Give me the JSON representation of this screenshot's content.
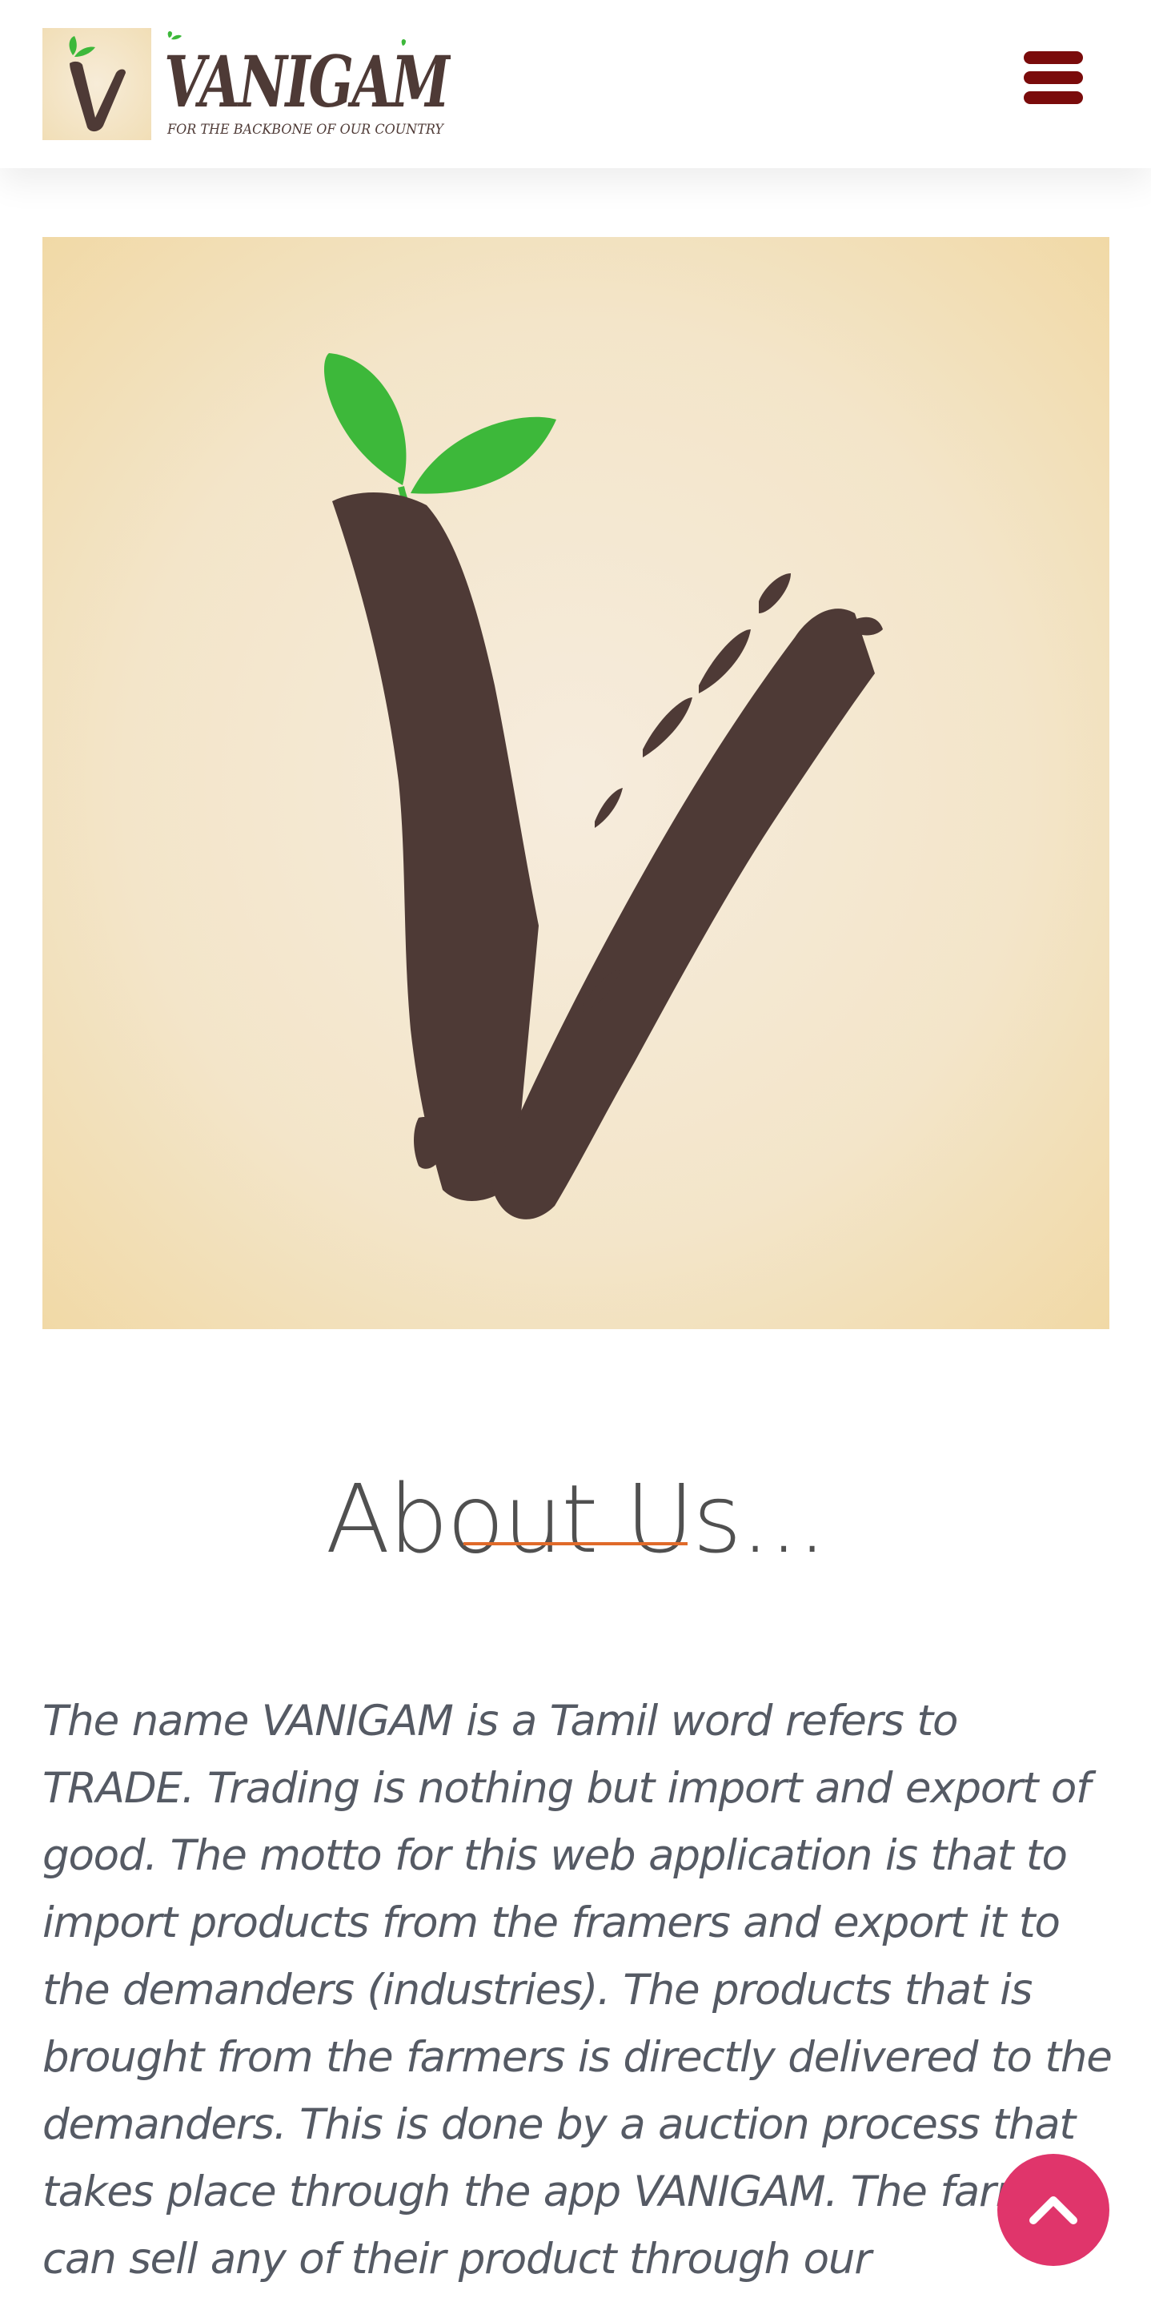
{
  "header": {
    "brand": {
      "name": "VANIGAM",
      "tagline": "FOR THE BACKBONE OF OUR COUNTRY",
      "mark_letter": "V"
    },
    "menu_icon": "hamburger-menu-icon"
  },
  "hero": {
    "image": "vanigam-logo-v-sprout"
  },
  "about": {
    "title": "About Us...",
    "body": "The name VANIGAM is a Tamil word refers to TRADE. Trading is nothing but import and export of good. The motto for this web application is that to import products from the framers and export it to the demanders (industries). The products that is brought from the farmers is directly delivered to the demanders. This is done by a auction process that takes place through the app VANIGAM. The farmer can sell any of their product through our application."
  },
  "back_to_top": {
    "icon": "chevron-up-icon"
  },
  "colors": {
    "brand_brown": "#4e3a36",
    "leaf_green": "#3db83a",
    "menu_red": "#7a0b0b",
    "accent_orange": "#e06a2a",
    "back_to_top_pink": "#e0356b",
    "body_text": "#555a64",
    "hero_background": "#f3e5c9"
  }
}
